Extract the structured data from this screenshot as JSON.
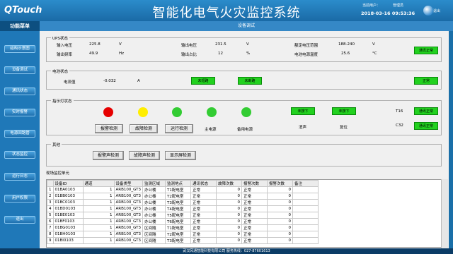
{
  "header": {
    "logo": "QTouch",
    "title": "智能化电气火灾监控系统",
    "user_label": "当前用户：",
    "user": "管理员",
    "datetime": "2018-03-16 09:53:36",
    "exit": "退出"
  },
  "sidebar": {
    "title": "功能菜单",
    "items": [
      "结构示意图",
      "设备调试",
      "通讯状态",
      "实时报警",
      "电源回路管",
      "状态监控",
      "运行日志",
      "用户权限",
      "退出"
    ]
  },
  "page_title": "设备调试",
  "ups": {
    "group": "UPS状态",
    "in_v_l": "输入电压",
    "in_v": "225.8",
    "in_v_u": "V",
    "in_f_l": "输出频率",
    "in_f": "49.9",
    "in_f_u": "Hz",
    "out_v_l": "输出电压",
    "out_v": "231.5",
    "out_v_u": "V",
    "out_r_l": "输出占比",
    "out_r": "12",
    "out_r_u": "%",
    "rated_l": "额定电压范围",
    "rated": "188-240",
    "rated_u": "V",
    "temp_l": "电池电源温度",
    "temp": "25.6",
    "temp_u": "°C",
    "status": "通讯正常"
  },
  "battery": {
    "group": "电池状态",
    "cur_l": "电流值",
    "cur": "-0.032",
    "cur_u": "A",
    "btn1": "未短路",
    "btn2": "未断路",
    "status": "正常"
  },
  "indicator": {
    "group": "指示灯状态",
    "b1": "报警检测",
    "b2": "故障检测",
    "b3": "运行检测",
    "lbl4": "主电源",
    "lbl5": "备用电源",
    "k1": "未按下",
    "k2": "未按下",
    "k1l": "消声",
    "k2l": "复位",
    "t16": "T16",
    "c32": "C32",
    "s1": "通讯正常",
    "s2": "通讯正常",
    "colors": {
      "red": "#e60000",
      "yellow": "#ffee00",
      "green": "#33cc33"
    }
  },
  "other": {
    "group": "其他",
    "b1": "报警声检测",
    "b2": "故障声检测",
    "b3": "显示屏检测"
  },
  "table": {
    "group": "现场监控单元",
    "headers": [
      "",
      "设备ID",
      "通道",
      "设备类型",
      "监测区域",
      "监测地点",
      "通讯状态",
      "故障次数",
      "报警次数",
      "报警次数",
      "备注"
    ],
    "rows": [
      [
        "1",
        "01BA0103",
        "1",
        "ARB100_GT3",
        "办公楼",
        "T1配电室",
        "正常",
        "0",
        "正常",
        "0",
        ""
      ],
      [
        "2",
        "01BB0103",
        "1",
        "ARB100_GT3",
        "办公楼",
        "T2配电室",
        "正常",
        "0",
        "正常",
        "0",
        ""
      ],
      [
        "3",
        "01BC0103",
        "1",
        "ARB100_GT3",
        "办公楼",
        "T3配电室",
        "正常",
        "0",
        "正常",
        "0",
        ""
      ],
      [
        "4",
        "01BD0103",
        "1",
        "ARB100_GT3",
        "办公楼",
        "T4配电室",
        "正常",
        "0",
        "正常",
        "0",
        ""
      ],
      [
        "5",
        "01BE0103",
        "1",
        "ARB100_GT3",
        "办公楼",
        "T5配电室",
        "正常",
        "0",
        "正常",
        "0",
        ""
      ],
      [
        "6",
        "01BF0103",
        "1",
        "ARB100_GT3",
        "办公楼",
        "T6配电室",
        "正常",
        "0",
        "正常",
        "0",
        ""
      ],
      [
        "7",
        "01BG0103",
        "1",
        "ARB100_GT3",
        "区间隧",
        "T1配电室",
        "正常",
        "0",
        "正常",
        "0",
        ""
      ],
      [
        "8",
        "01BH0103",
        "1",
        "ARB100_GT3",
        "区间隧",
        "T2配电室",
        "正常",
        "0",
        "正常",
        "0",
        ""
      ],
      [
        "9",
        "01BI0103",
        "1",
        "ARB100_GT3",
        "区间隧",
        "T3配电室",
        "正常",
        "0",
        "正常",
        "0",
        ""
      ]
    ]
  },
  "footer": "武汉风通智能科技有限公司   服务热线：027-87601613"
}
